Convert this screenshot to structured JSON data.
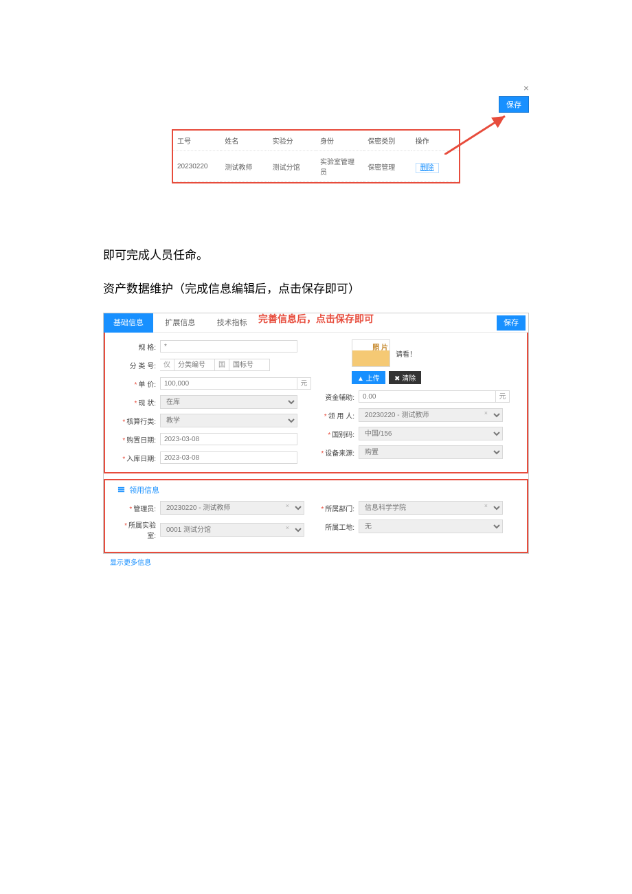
{
  "corner": {
    "close": "×",
    "save": "保存"
  },
  "table": {
    "headers": [
      "工号",
      "姓名",
      "实验分",
      "身份",
      "保密类别",
      "操作"
    ],
    "row": {
      "id": "20230220",
      "name": "测试教师",
      "lab": "测试分馆",
      "role": "实验室管理员",
      "secrecy": "保密管理",
      "op": "删除"
    }
  },
  "doc": {
    "line1": "即可完成人员任命。",
    "line2": "资产数据维护（完成信息编辑后，点击保存即可）"
  },
  "form": {
    "banner": "完善信息后，点击保存即可",
    "tabs": {
      "basic": "基础信息",
      "ext": "扩展信息",
      "tech": "技术指标",
      "save": "保存"
    },
    "fields": {
      "spec_label": "规 格:",
      "spec_val": "*",
      "model_label": "分 类 号:",
      "model_prefix": "仪",
      "model_v1": "分类编号",
      "model_mid": "国",
      "model_v2": "国标号",
      "price_label": "单 价:",
      "price_val": "100,000",
      "price_unit": "元",
      "acc_label": "资金辅助:",
      "acc_val": "0.00",
      "acc_unit": "元",
      "status_label": "现 状:",
      "status_val": "在库",
      "keeper_label": "领 用 人:",
      "keeper_val": "20230220 - 测试教师",
      "class_label": "核算行类:",
      "class_val": "教学",
      "country_label": "国别码:",
      "country_val": "中国/156",
      "buy_date_label": "购置日期:",
      "buy_date_val": "2023-03-08",
      "src_label": "设备来源:",
      "src_val": "购置",
      "in_date_label": "入库日期:",
      "in_date_val": "2023-03-08"
    },
    "photo": {
      "caption": "照 片",
      "hint": "请看！",
      "upload": "▲ 上传",
      "clear": "✖ 清除"
    },
    "section2": {
      "title": "领用信息",
      "mgr_label": "管理员:",
      "mgr_val": "20230220 - 测试教师",
      "dept_label": "所属部门:",
      "dept_val": "信息科学学院",
      "room_label": "所属实验室:",
      "room_val": "0001 测试分馆",
      "site_label": "所属工地:",
      "site_val": "无"
    }
  },
  "footer": "显示更多信息"
}
